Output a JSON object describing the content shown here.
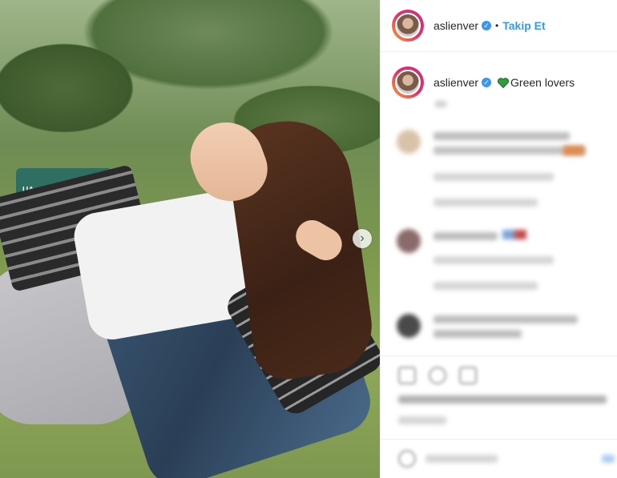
{
  "post": {
    "username": "aslienver",
    "follow_label": "Takip Et",
    "separator": "•",
    "caption": "Green lovers",
    "caption_emoji": "green-heart-icon",
    "next_icon": "chevron-right-icon",
    "chair_text": "UA"
  },
  "colors": {
    "accent": "#3897f0",
    "verified": "#3897f0",
    "heart": "#2e9e3a"
  }
}
